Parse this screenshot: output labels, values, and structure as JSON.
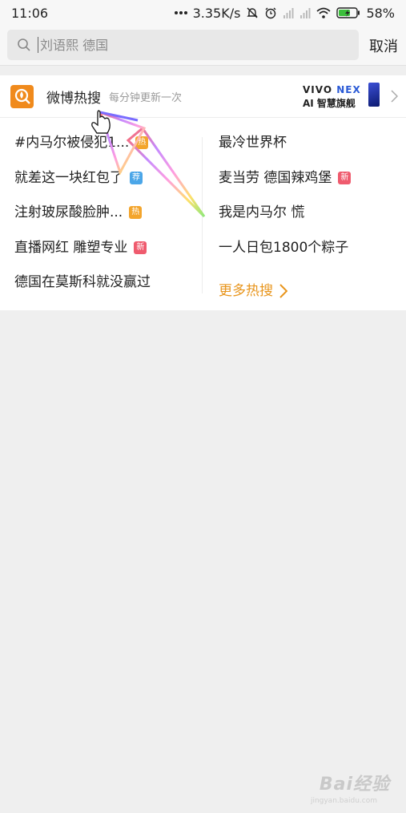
{
  "status_bar": {
    "time": "11:06",
    "speed": "3.35K/s",
    "battery": "58%",
    "icons": [
      "dots-icon",
      "mute-bell-icon",
      "alarm-icon",
      "signal-icon",
      "signal-icon",
      "wifi-icon",
      "battery-icon"
    ]
  },
  "search": {
    "placeholder": "刘语熙 德国",
    "cancel_label": "取消",
    "icon": "search-icon"
  },
  "hot_panel": {
    "title": "微博热搜",
    "subtitle": "每分钟更新一次",
    "ad": {
      "brand": "VIVO",
      "model": "NEX",
      "tagline": "AI 智慧旗舰"
    },
    "left_items": [
      {
        "text": "#内马尔被侵犯1...",
        "badge": "热",
        "badge_type": "hot"
      },
      {
        "text": "就差这一块红包了",
        "badge": "荐",
        "badge_type": "rec"
      },
      {
        "text": "注射玻尿酸脸肿...",
        "badge": "热",
        "badge_type": "hot"
      },
      {
        "text": "直播网红 雕塑专业",
        "badge": "新",
        "badge_type": "new"
      },
      {
        "text": "德国在莫斯科就没赢过",
        "badge": "",
        "badge_type": ""
      }
    ],
    "right_items": [
      {
        "text": "最冷世界杯",
        "badge": "",
        "badge_type": ""
      },
      {
        "text": "麦当劳 德国辣鸡堡",
        "badge": "新",
        "badge_type": "new"
      },
      {
        "text": "我是内马尔 慌",
        "badge": "",
        "badge_type": ""
      },
      {
        "text": "一人日包1800个粽子",
        "badge": "",
        "badge_type": ""
      }
    ],
    "more_label": "更多热搜"
  },
  "watermark": {
    "text": "Bai经验",
    "sub": "jingyan.baidu.com"
  },
  "colors": {
    "accent_orange": "#e8951c",
    "badge_hot": "#f3a52d",
    "badge_rec": "#4ba6e8",
    "badge_new": "#ef5b6e"
  }
}
